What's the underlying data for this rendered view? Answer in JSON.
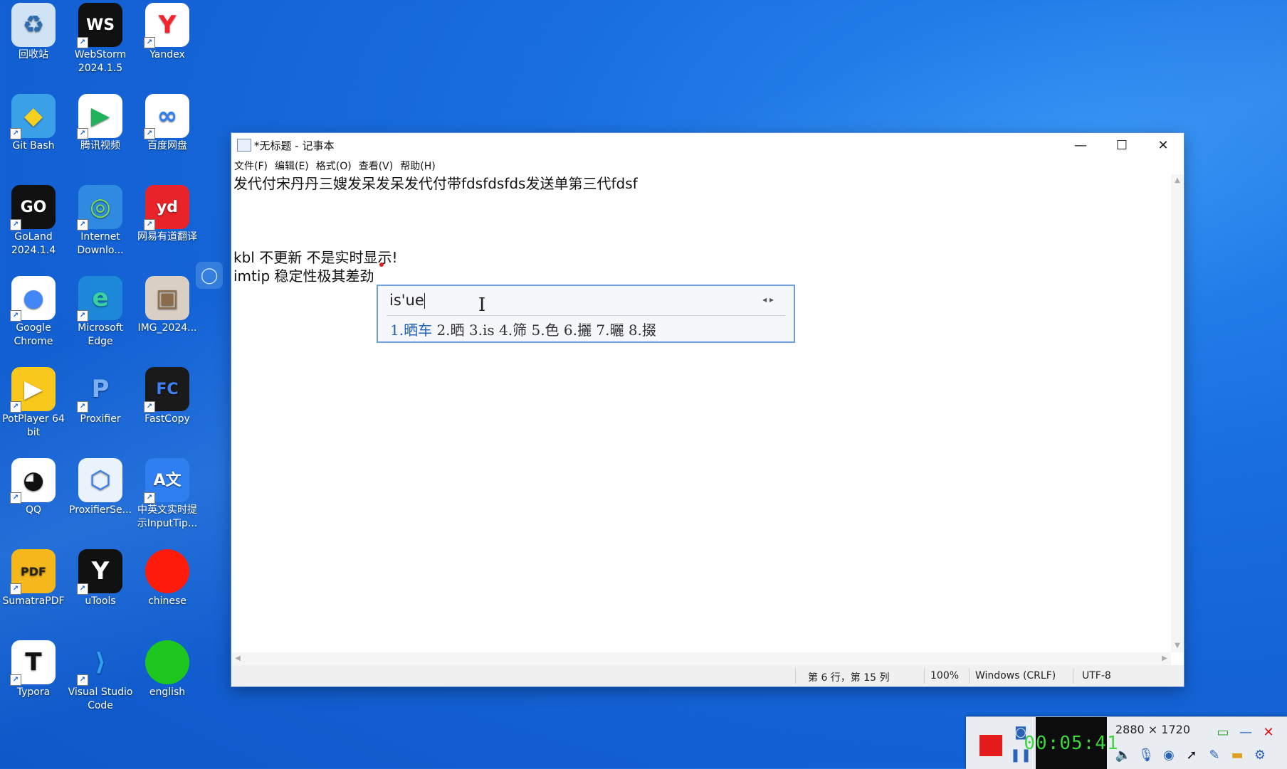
{
  "desktop": {
    "icons": [
      {
        "label": "回收站",
        "glyph": "♻",
        "bg": "#cfe3f5",
        "fg": "#2b6cb0",
        "shortcut": false
      },
      {
        "label": "WebStorm 2024.1.5",
        "glyph": "WS",
        "bg": "#111111",
        "fg": "#ffffff",
        "shortcut": true
      },
      {
        "label": "Yandex",
        "glyph": "Y",
        "bg": "#ffffff",
        "fg": "#f5222d",
        "shortcut": true
      },
      {
        "label": "Git Bash",
        "glyph": "◆",
        "bg": "#3aa0e8",
        "fg": "#f5d020",
        "shortcut": true
      },
      {
        "label": "腾讯视频",
        "glyph": "▶",
        "bg": "#ffffff",
        "fg": "#21b35c",
        "shortcut": true
      },
      {
        "label": "百度网盘",
        "glyph": "∞",
        "bg": "#ffffff",
        "fg": "#2f7ff0",
        "shortcut": true
      },
      {
        "label": "GoLand 2024.1.4",
        "glyph": "GO",
        "bg": "#111111",
        "fg": "#ffffff",
        "shortcut": true
      },
      {
        "label": "Internet Downlo...",
        "glyph": "◎",
        "bg": "#2e8be0",
        "fg": "#7ed957",
        "shortcut": true
      },
      {
        "label": "网易有道翻译",
        "glyph": "yd",
        "bg": "#e8242a",
        "fg": "#ffffff",
        "shortcut": true
      },
      {
        "label": "Google Chrome",
        "glyph": "●",
        "bg": "#ffffff",
        "fg": "#4285f4",
        "shortcut": true
      },
      {
        "label": "Microsoft Edge",
        "glyph": "e",
        "bg": "#1e88d8",
        "fg": "#39d1a0",
        "shortcut": true
      },
      {
        "label": "IMG_2024...",
        "glyph": "▣",
        "bg": "#d9cfc4",
        "fg": "#8a6b4a",
        "shortcut": false
      },
      {
        "label": "PotPlayer 64 bit",
        "glyph": "▶",
        "bg": "#f8c81c",
        "fg": "#ffffff",
        "shortcut": true
      },
      {
        "label": "Proxifier",
        "glyph": "P",
        "bg": "transparent",
        "fg": "#7aaef5",
        "shortcut": true
      },
      {
        "label": "FastCopy",
        "glyph": "FC",
        "bg": "#1a1a1a",
        "fg": "#3d7ff5",
        "shortcut": true
      },
      {
        "label": "QQ",
        "glyph": "◕",
        "bg": "#ffffff",
        "fg": "#111111",
        "shortcut": true
      },
      {
        "label": "ProxifierSe...",
        "glyph": "⬡",
        "bg": "#eaf2fb",
        "fg": "#2f7ff0",
        "shortcut": false
      },
      {
        "label": "中英文实时提示InputTip...",
        "glyph": "A文",
        "bg": "#2f7ff0",
        "fg": "#ffffff",
        "shortcut": true
      },
      {
        "label": "SumatraPDF",
        "glyph": "PDF",
        "bg": "#f5b81c",
        "fg": "#222222",
        "shortcut": true
      },
      {
        "label": "uTools",
        "glyph": "Y",
        "bg": "#111111",
        "fg": "#ffffff",
        "shortcut": true
      },
      {
        "label": "chinese",
        "glyph": "",
        "bg": "#ff1a0a",
        "fg": "#ffffff",
        "shortcut": false
      },
      {
        "label": "Typora",
        "glyph": "T",
        "bg": "#ffffff",
        "fg": "#111111",
        "shortcut": true
      },
      {
        "label": "Visual Studio Code",
        "glyph": "⟩",
        "bg": "transparent",
        "fg": "#2fa0f0",
        "shortcut": true
      },
      {
        "label": "english",
        "glyph": "",
        "bg": "#1ec71e",
        "fg": "#ffffff",
        "shortcut": false
      }
    ]
  },
  "notepad": {
    "title": "*无标题 - 记事本",
    "controls": {
      "minimize": "—",
      "maximize": "☐",
      "close": "✕"
    },
    "menu": [
      "文件(F)",
      "编辑(E)",
      "格式(O)",
      "查看(V)",
      "帮助(H)"
    ],
    "lines": [
      "发代付宋丹丹三嫂发呆发呆发代付带fdsfdsfds发送单第三代fdsf",
      "",
      "",
      "",
      "kbl 不更新 不是实时显示!",
      "imtip 稳定性极其差劲"
    ],
    "status": {
      "position": "第 6 行，第 15 列",
      "zoom": "100%",
      "line_ending": "Windows (CRLF)",
      "encoding": "UTF-8"
    }
  },
  "ime": {
    "composition": "is'ue",
    "pager": "◂ ▸",
    "candidates": [
      "1.晒车",
      "2.晒",
      "3.is",
      "4.筛",
      "5.色",
      "6.攦",
      "7.曬",
      "8.掇"
    ]
  },
  "recorder": {
    "timer": "00:05:41",
    "resolution": "2880 × 1720",
    "colors": {
      "stop": "#e51b1b",
      "timer_fg": "#3cd63c"
    }
  }
}
